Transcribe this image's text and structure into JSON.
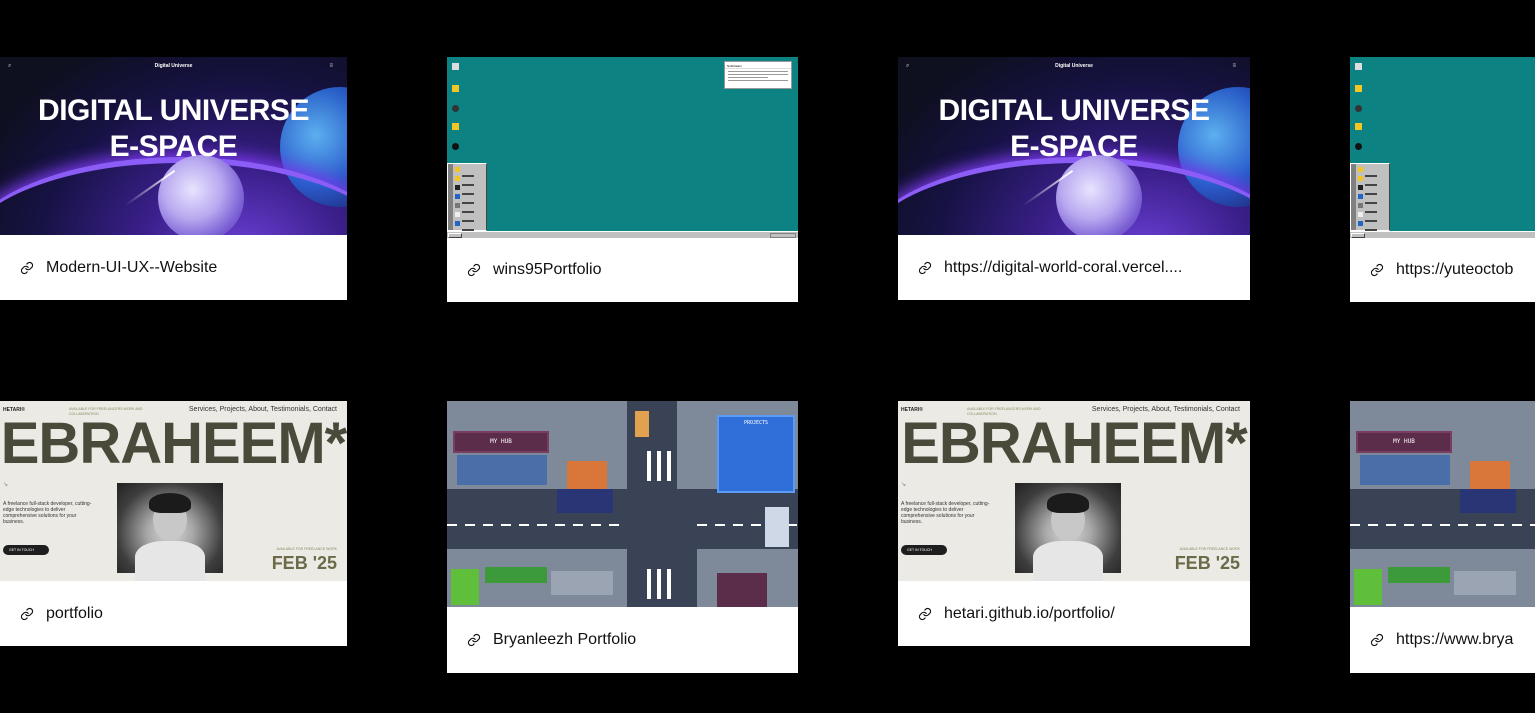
{
  "cards": [
    {
      "label": "Modern-UI-UX--Website"
    },
    {
      "label": "wins95Portfolio"
    },
    {
      "label": "https://digital-world-coral.vercel...."
    },
    {
      "label": "https://yuteoctob"
    },
    {
      "label": "portfolio"
    },
    {
      "label": "Bryanleezh Portfolio"
    },
    {
      "label": "hetari.github.io/portfolio/"
    },
    {
      "label": "https://www.brya"
    }
  ],
  "thumbs": {
    "digital": {
      "nav_title": "Digital Universe",
      "line1": "DIGITAL UNIVERSE",
      "line2": "E-SPACE"
    },
    "win95": {
      "notif_title": "Notification"
    },
    "ebraheem": {
      "logo": "HETARI®",
      "available": "AVAILABLE FOR FREELANCERS WORK AND COLLABORATION",
      "links": "Services, Projects, About, Testimonials, Contact",
      "name": "EBRAHEEM*",
      "arrow": "↘",
      "desc": "A freelance full-stack developer, cutting-edge technologies to deliver comprehensive solutions for your business.",
      "cta": "GET IN TOUCH",
      "available2": "AVAILABLE FOR FREELANCE WORK",
      "date": "FEB '25"
    },
    "pixel": {
      "sign": "MY HUB",
      "projects": "PROJECTS"
    }
  },
  "colors": {
    "background": "#000000",
    "card": "#ffffff",
    "text": "#111111"
  }
}
